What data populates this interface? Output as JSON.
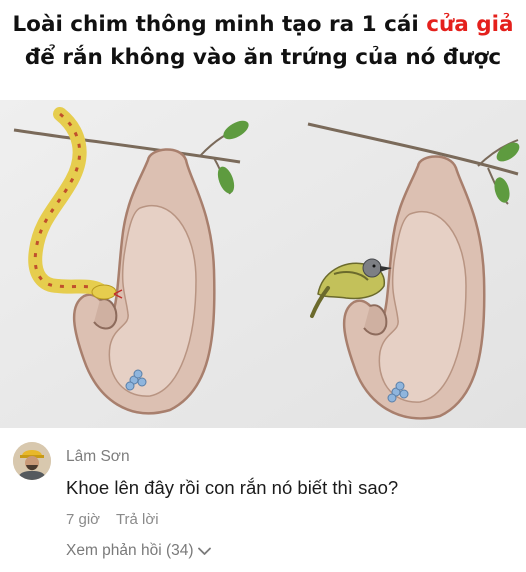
{
  "caption": {
    "line1_prefix": "Loài chim thông minh tạo ra 1 cái ",
    "line1_highlight": "cửa giả",
    "line2": "để rắn không vào ăn trứng của nó được"
  },
  "colors": {
    "highlight": "#e4201c",
    "nest_fill": "#dcc0b2",
    "nest_stroke": "#a87f6d",
    "snake": "#e6cd4e",
    "snake_pattern": "#c0502c",
    "leaf": "#5e9b3f",
    "bird_body": "#c3c15a",
    "egg_blue": "#8fb5dd"
  },
  "comment": {
    "author": "Lâm Sơn",
    "text": "Khoe lên đây rồi con rắn nó biết thì sao?",
    "time": "7 giờ",
    "reply_label": "Trả lời",
    "view_replies": "Xem phản hồi (34)"
  }
}
